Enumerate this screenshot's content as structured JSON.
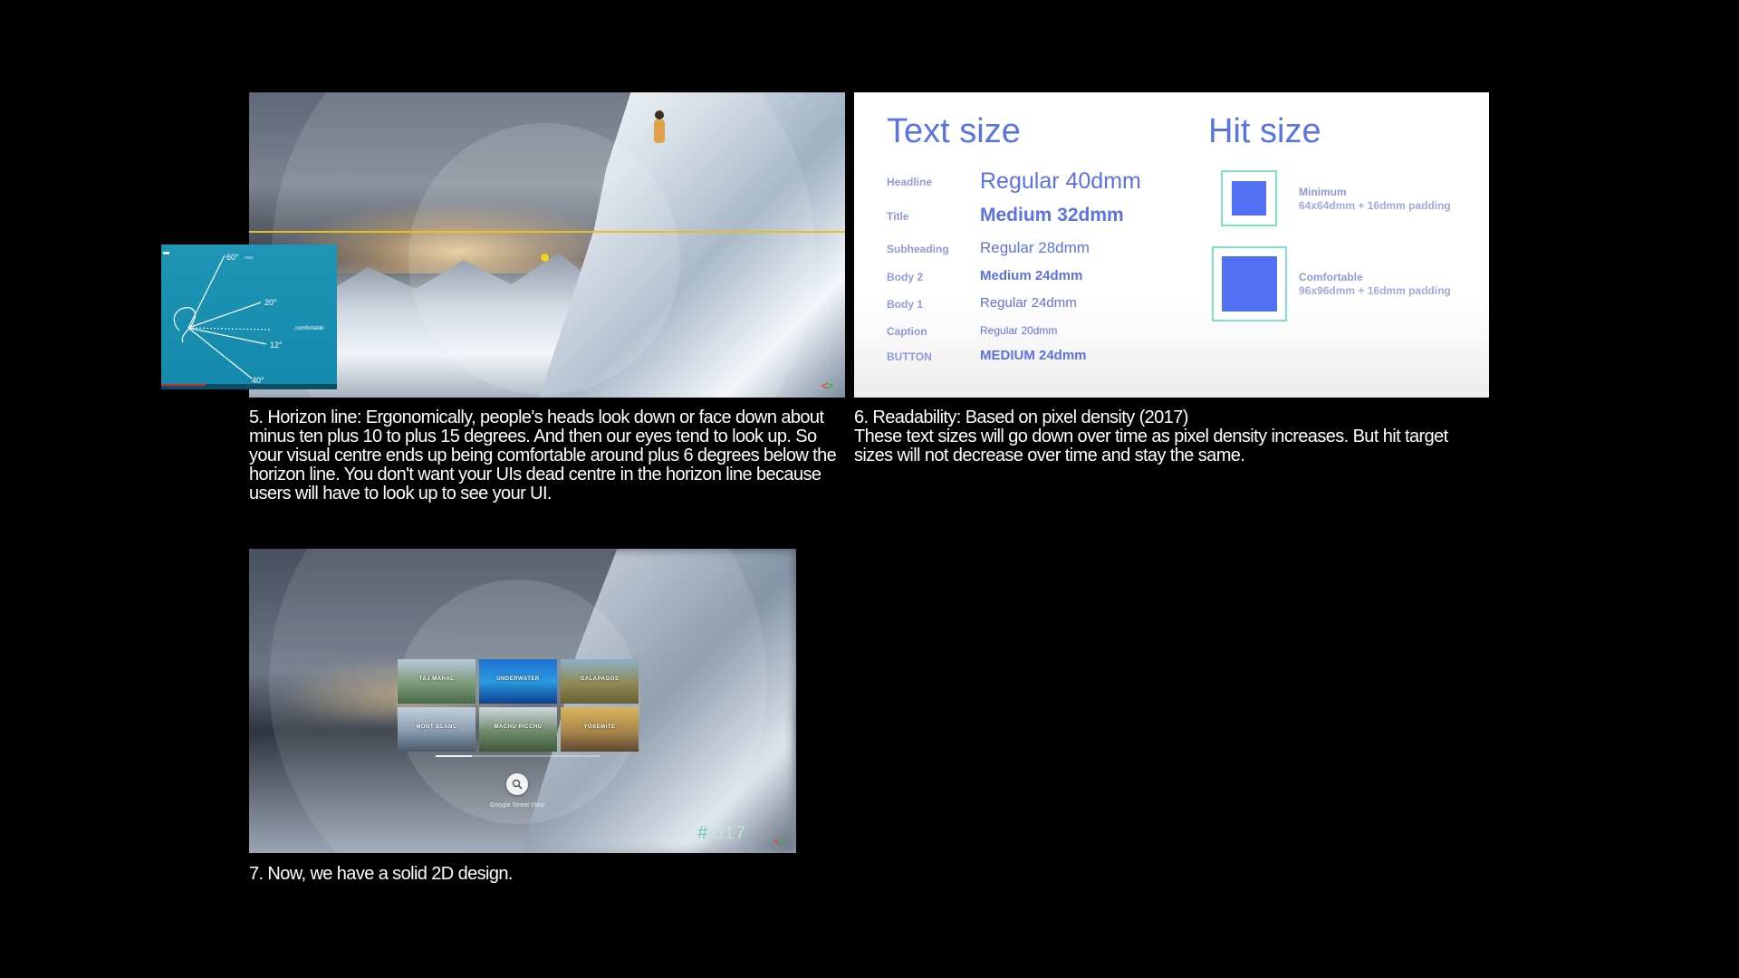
{
  "slides": {
    "horizon": {
      "caption": "5. Horizon line: Ergonomically, people's heads look down or face down about minus ten plus 10 to plus 15 degrees. And then our eyes tend to look up. So your visual centre ends up being comfortable around plus 6 degrees below the horizon line. You don't want your UIs dead centre in the horizon line because users will have to look up to see your UI.",
      "horizon_color": "#e6c11c",
      "inset": {
        "angle_max_label": "60°",
        "angle_max_sub": "max",
        "angle_mid_label": "20°",
        "angle_low_label": "12°",
        "angle_bottom_label": "40°",
        "comfortable_label": "comfortable",
        "playback_progress": 0.25
      }
    },
    "readability": {
      "title": "6. Readability: Based on pixel density (2017)",
      "caption": "These text sizes will go down over time as pixel density increases. But hit target sizes will not decrease over time and stay the same.",
      "text_size_heading": "Text size",
      "hit_size_heading": "Hit size",
      "accent_color": "#5a74e6",
      "rows": [
        {
          "label": "Headline",
          "value": "Regular 40dmm"
        },
        {
          "label": "Title",
          "value": "Medium 32dmm"
        },
        {
          "label": "Subheading",
          "value": "Regular 28dmm"
        },
        {
          "label": "Body 2",
          "value": "Medium 24dmm"
        },
        {
          "label": "Body 1",
          "value": "Regular 24dmm"
        },
        {
          "label": "Caption",
          "value": "Regular 20dmm"
        },
        {
          "label": "BUTTON",
          "value": "MEDIUM 24dmm"
        }
      ],
      "hit_targets": [
        {
          "name": "Minimum",
          "desc": "64x64dmm + 16dmm padding"
        },
        {
          "name": "Comfortable",
          "desc": "96x96dmm + 16dmm padding"
        }
      ]
    },
    "design2d": {
      "caption": "7. Now, we have a solid 2D design.",
      "tiles": [
        {
          "label": "TAJ MAHAL"
        },
        {
          "label": "UNDERWATER"
        },
        {
          "label": "GALAPAGOS"
        },
        {
          "label": "MONT BLANC"
        },
        {
          "label": "MACHU PICCHU"
        },
        {
          "label": "YOSEMITE"
        }
      ],
      "search_caption": "Google Street View",
      "hashtag_hash": "#",
      "hashtag_text": "io17"
    }
  }
}
